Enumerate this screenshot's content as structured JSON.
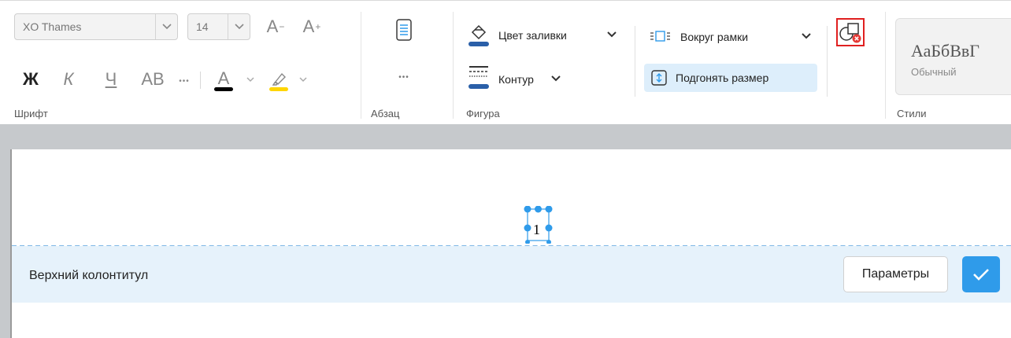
{
  "ribbon": {
    "font_group": {
      "label": "Шрифт",
      "font_name": "XO Thames",
      "font_size": "14",
      "grow_font": "A",
      "shrink_font": "A",
      "bold": "Ж",
      "italic": "К",
      "underline": "Ч",
      "strikethrough": "АВ",
      "more": "•••",
      "font_color_letter": "А",
      "font_color": "#000000",
      "highlight_color": "#ffd500"
    },
    "paragraph_group": {
      "label": "Абзац",
      "more": "•••"
    },
    "shape_group": {
      "label": "Фигура",
      "fill_label": "Цвет заливки",
      "outline_label": "Контур",
      "wrap_label": "Вокруг рамки",
      "autofit_label": "Подгонять размер"
    },
    "styles_group": {
      "label": "Стили",
      "sample": "АаБбВвГ",
      "style_name": "Обычный"
    }
  },
  "document": {
    "page_number": "1",
    "header_label": "Верхний колонтитул",
    "params_button": "Параметры"
  },
  "colors": {
    "accent": "#2f9bea",
    "header_band": "#e6f2fb",
    "highlight_box": "#e02020"
  }
}
